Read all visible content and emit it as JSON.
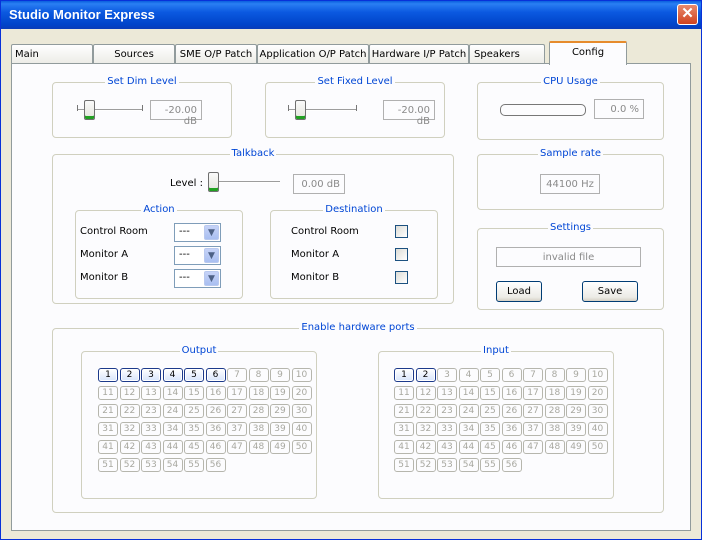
{
  "window": {
    "title": "Studio Monitor Express"
  },
  "tabs": [
    "Main",
    "Sources",
    "SME O/P Patch",
    "Application O/P Patch",
    "Hardware I/P Patch",
    "Speakers",
    "Config"
  ],
  "active_tab": "Config",
  "dim_level": {
    "title": "Set Dim Level",
    "value": "-20.00 dB",
    "slider_fraction": 0.18
  },
  "fixed_level": {
    "title": "Set Fixed Level",
    "value": "-20.00 dB",
    "slider_fraction": 0.18
  },
  "cpu": {
    "title": "CPU Usage",
    "value": "0.0 %",
    "fraction": 0.0
  },
  "talkback": {
    "title": "Talkback",
    "level_label": "Level :",
    "level_value": "0.00 dB",
    "slider_fraction": 0.0,
    "action": {
      "title": "Action",
      "rows": [
        {
          "label": "Control Room",
          "value": "---"
        },
        {
          "label": "Monitor A",
          "value": "---"
        },
        {
          "label": "Monitor B",
          "value": "---"
        }
      ]
    },
    "destination": {
      "title": "Destination",
      "rows": [
        {
          "label": "Control Room",
          "checked": false
        },
        {
          "label": "Monitor A",
          "checked": false
        },
        {
          "label": "Monitor B",
          "checked": false
        }
      ]
    }
  },
  "sample_rate": {
    "title": "Sample rate",
    "value": "44100 Hz"
  },
  "settings": {
    "title": "Settings",
    "file": "invalid file",
    "load_label": "Load",
    "save_label": "Save"
  },
  "hardware_ports": {
    "title": "Enable hardware ports",
    "output": {
      "title": "Output",
      "count": 56,
      "enabled": [
        1,
        2,
        3,
        4,
        5,
        6
      ]
    },
    "input": {
      "title": "Input",
      "count": 56,
      "enabled": [
        1,
        2
      ]
    }
  },
  "colors": {
    "group_title": "#0046d5",
    "title_bar": "#0043c9",
    "active_tab": "#e68b2c"
  }
}
